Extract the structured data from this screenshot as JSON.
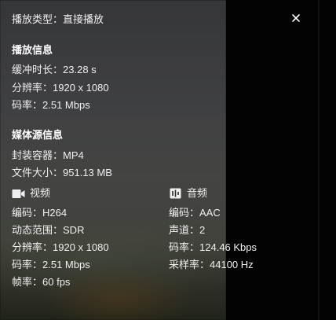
{
  "play_type": {
    "label": "播放类型：",
    "value": "直接播放"
  },
  "playback_info": {
    "title": "播放信息",
    "buffer_label": "缓冲时长：",
    "buffer_value": "23.28 s",
    "resolution_label": "分辨率：",
    "resolution_value": "1920 x 1080",
    "bitrate_label": "码率：",
    "bitrate_value": "2.51 Mbps"
  },
  "media_source": {
    "title": "媒体源信息",
    "container_label": "封装容器：",
    "container_value": "MP4",
    "size_label": "文件大小：",
    "size_value": "951.13 MB"
  },
  "video": {
    "title": "视频",
    "icon": "video-camera-icon",
    "codec_label": "编码：",
    "codec_value": "H264",
    "range_label": "动态范围：",
    "range_value": "SDR",
    "resolution_label": "分辨率：",
    "resolution_value": "1920 x 1080",
    "bitrate_label": "码率：",
    "bitrate_value": "2.51 Mbps",
    "framerate_label": "帧率：",
    "framerate_value": "60 fps"
  },
  "audio": {
    "title": "音频",
    "icon": "audio-equalizer-icon",
    "codec_label": "编码：",
    "codec_value": "AAC",
    "channels_label": "声道：",
    "channels_value": "2",
    "bitrate_label": "码率：",
    "bitrate_value": "124.46 Kbps",
    "samplerate_label": "采样率：",
    "samplerate_value": "44100 Hz"
  },
  "colors": {
    "text": "#f0f0f0",
    "heading": "#ffffff",
    "backdrop": "#000000"
  }
}
